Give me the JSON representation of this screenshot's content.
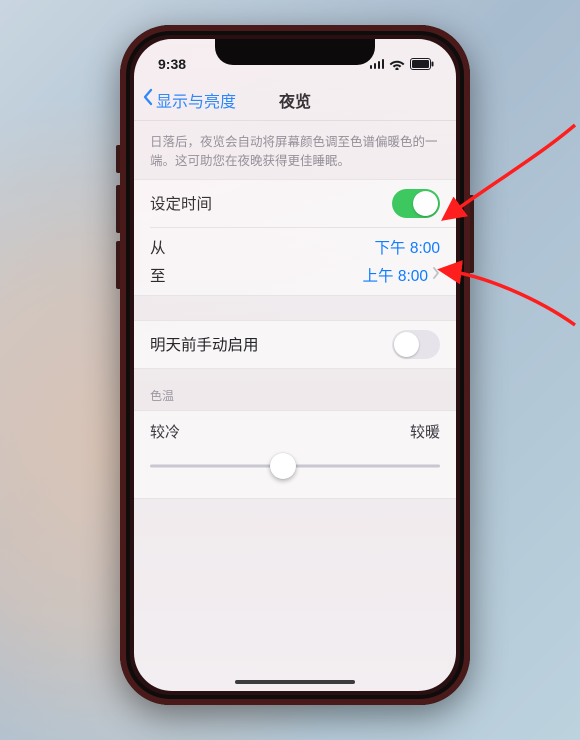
{
  "status": {
    "time": "9:38"
  },
  "nav": {
    "back_label": "显示与亮度",
    "title": "夜览"
  },
  "hint": "日落后，夜览会自动将屏幕颜色调至色谱偏暖色的一端。这可助您在夜晚获得更佳睡眠。",
  "schedule": {
    "toggle_label": "设定时间",
    "toggle_on": true,
    "from_label": "从",
    "to_label": "至",
    "from_value": "下午 8:00",
    "to_value": "上午 8:00"
  },
  "manual": {
    "label": "明天前手动启用",
    "on": false
  },
  "temp": {
    "section": "色温",
    "cold": "较冷",
    "warm": "较暖",
    "slider_percent": 46
  },
  "colors": {
    "link": "#0a7aff",
    "switch_on": "#34c759",
    "arrow": "#ff1e1e"
  }
}
